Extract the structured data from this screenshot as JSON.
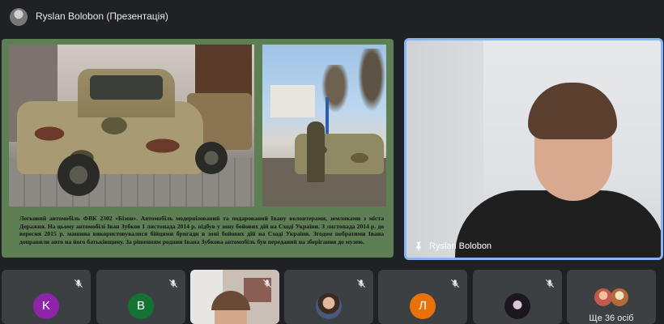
{
  "presenter_bar": {
    "title": "Ryslan Bolobon (Презентація)"
  },
  "slide": {
    "background": "#5e7e54",
    "caption": "Легковий автомобіль ФВК 2302 «Бізон». Автомобіль модернізований та подарований Івану волонтерами, земляками з міста Деражня. На цьому автомобілі Іван Зубков 1 листопада 2014 р. відбув у зону бойових дій на Сході України. З листопада 2014 р. до вересня 2015 р. машина використовувалися бійцями бригади в зоні бойових дій на Сході України. Згодом побратими Івана доправили авто на його батьківщину. За рішенням родини Івана Зубкова автомобіль був переданий на зберігання до музею."
  },
  "main_speaker": {
    "name": "Ryslan Bolobon",
    "border_color": "#8ab4f8"
  },
  "participants": [
    {
      "type": "letter",
      "letter": "K",
      "color": "#8e24aa"
    },
    {
      "type": "letter",
      "letter": "B",
      "color": "#137333"
    },
    {
      "type": "video"
    },
    {
      "type": "photo"
    },
    {
      "type": "letter",
      "letter": "Л",
      "color": "#e8710a"
    },
    {
      "type": "photo"
    },
    {
      "type": "more",
      "label": "Ще 36 осіб"
    }
  ]
}
